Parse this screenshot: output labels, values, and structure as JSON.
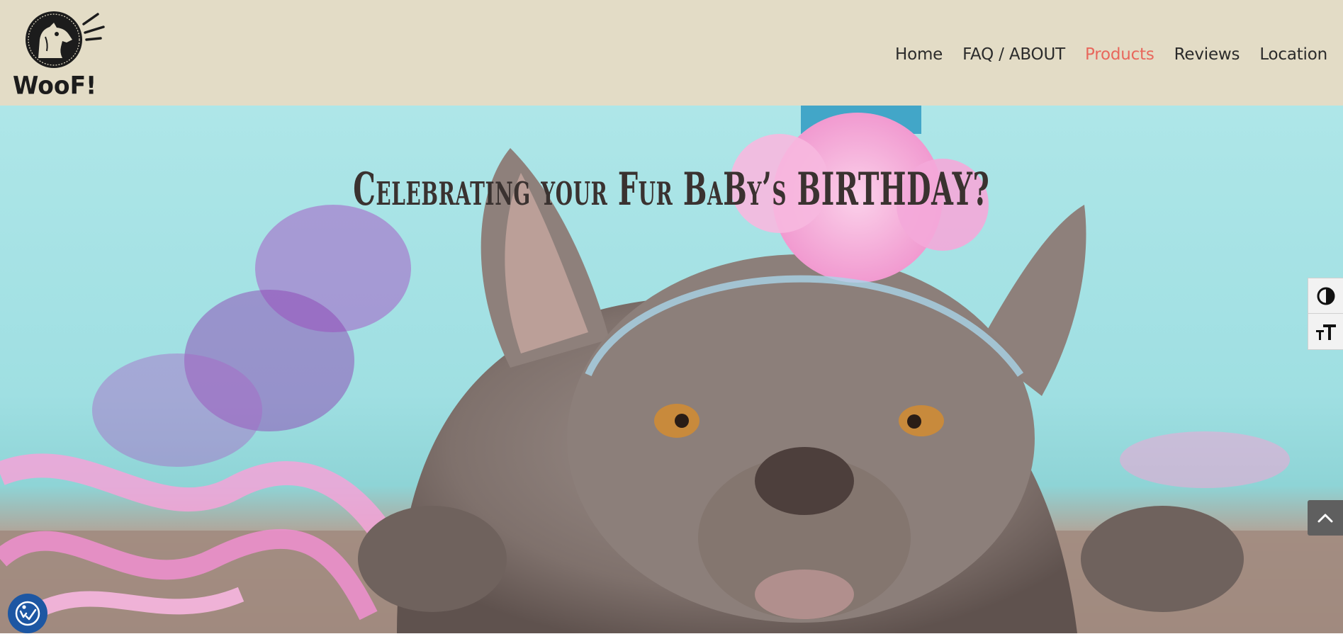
{
  "brand": {
    "logo_text": "WooF!"
  },
  "nav": {
    "items": [
      {
        "label": "Home",
        "active": false
      },
      {
        "label": "FAQ / ABOUT",
        "active": false
      },
      {
        "label": "Products",
        "active": true
      },
      {
        "label": "Reviews",
        "active": false
      },
      {
        "label": "Location",
        "active": false
      }
    ]
  },
  "hero": {
    "title": "Celebrating your Fur BaBy’s BIRTHDAY?"
  },
  "tools": {
    "contrast_icon": "contrast-icon",
    "text_size_icon": "text-size-icon",
    "scroll_top_icon": "chevron-up-icon",
    "accessibility_icon": "accessibility-check-icon"
  },
  "colors": {
    "header_bg": "#e3dcc6",
    "nav_active": "#e8675c",
    "nav_text": "#2b2b2b",
    "widget_blue": "#1d57a3"
  }
}
